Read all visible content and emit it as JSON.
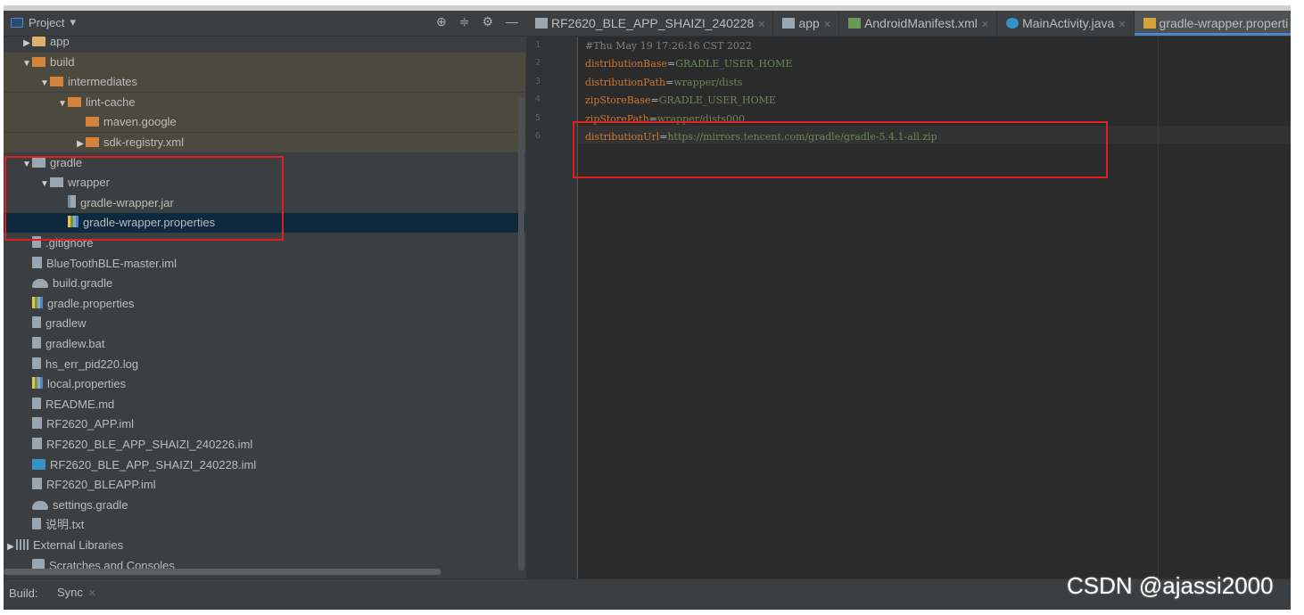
{
  "project_panel": {
    "title": "Project",
    "tools": [
      "⊕",
      "≑",
      "⚙",
      "—"
    ]
  },
  "tree": [
    {
      "depth": 1,
      "arrow": "▶",
      "icon": "folder",
      "label": "app",
      "partial": true
    },
    {
      "depth": 1,
      "arrow": "▼",
      "icon": "folder-orange",
      "label": "build"
    },
    {
      "depth": 2,
      "arrow": "▼",
      "icon": "folder-orange",
      "label": "intermediates"
    },
    {
      "depth": 3,
      "arrow": "▼",
      "icon": "folder-orange",
      "label": "lint-cache"
    },
    {
      "depth": 4,
      "arrow": "",
      "icon": "folder-orange",
      "label": "maven.google"
    },
    {
      "depth": 4,
      "arrow": "▶",
      "icon": "folder-orange",
      "label": "sdk-registry.xml"
    },
    {
      "depth": 1,
      "arrow": "▼",
      "icon": "folder-grey",
      "label": "gradle"
    },
    {
      "depth": 2,
      "arrow": "▼",
      "icon": "folder-grey",
      "label": "wrapper"
    },
    {
      "depth": 3,
      "arrow": "",
      "icon": "jar",
      "label": "gradle-wrapper.jar"
    },
    {
      "depth": 3,
      "arrow": "",
      "icon": "props",
      "label": "gradle-wrapper.properties",
      "selected": true
    },
    {
      "depth": 1,
      "arrow": "",
      "icon": "file",
      "label": ".gitignore"
    },
    {
      "depth": 1,
      "arrow": "",
      "icon": "iml",
      "label": "BlueToothBLE-master.iml"
    },
    {
      "depth": 1,
      "arrow": "",
      "icon": "gradle",
      "label": "build.gradle"
    },
    {
      "depth": 1,
      "arrow": "",
      "icon": "props",
      "label": "gradle.properties"
    },
    {
      "depth": 1,
      "arrow": "",
      "icon": "file",
      "label": "gradlew"
    },
    {
      "depth": 1,
      "arrow": "",
      "icon": "file",
      "label": "gradlew.bat"
    },
    {
      "depth": 1,
      "arrow": "",
      "icon": "file",
      "label": "hs_err_pid220.log"
    },
    {
      "depth": 1,
      "arrow": "",
      "icon": "props",
      "label": "local.properties"
    },
    {
      "depth": 1,
      "arrow": "",
      "icon": "file",
      "label": "README.md"
    },
    {
      "depth": 1,
      "arrow": "",
      "icon": "iml",
      "label": "RF2620_APP.iml"
    },
    {
      "depth": 1,
      "arrow": "",
      "icon": "iml",
      "label": "RF2620_BLE_APP_SHAIZI_240226.iml"
    },
    {
      "depth": 1,
      "arrow": "",
      "icon": "iml-blue",
      "label": "RF2620_BLE_APP_SHAIZI_240228.iml"
    },
    {
      "depth": 1,
      "arrow": "",
      "icon": "iml",
      "label": "RF2620_BLEAPP.iml"
    },
    {
      "depth": 1,
      "arrow": "",
      "icon": "gradle",
      "label": "settings.gradle"
    },
    {
      "depth": 1,
      "arrow": "",
      "icon": "file",
      "label": "说明.txt"
    },
    {
      "depth": 0,
      "arrow": "▶",
      "icon": "libs",
      "label": "External Libraries"
    },
    {
      "depth": 1,
      "arrow": "",
      "icon": "scratch",
      "label": "Scratches and Consoles"
    }
  ],
  "tabs": [
    {
      "label": "RF2620_BLE_APP_SHAIZI_240228",
      "icon": "gradle-icon"
    },
    {
      "label": "app",
      "icon": "gradle-icon"
    },
    {
      "label": "AndroidManifest.xml",
      "icon": "manifest-icon"
    },
    {
      "label": "MainActivity.java",
      "icon": "java-class-icon"
    },
    {
      "label": "gradle-wrapper.properti",
      "icon": "properties-icon",
      "active": true
    }
  ],
  "editor": {
    "lines": [
      {
        "n": "1",
        "comment": "#Thu May 19 17:26:16 CST 2022"
      },
      {
        "n": "2",
        "key": "distributionBase",
        "value": "GRADLE_USER_HOME"
      },
      {
        "n": "3",
        "key": "distributionPath",
        "value": "wrapper/dists"
      },
      {
        "n": "4",
        "key": "zipStoreBase",
        "value": "GRADLE_USER_HOME"
      },
      {
        "n": "5",
        "key": "zipStorePath",
        "value": "wrapper/dists000"
      },
      {
        "n": "6",
        "key": "distributionUrl",
        "value": "https://mirrors.tencent.com/gradle/gradle-5.4.1-all.zip"
      }
    ]
  },
  "bottom": {
    "build_label": "Build:",
    "sync_label": "Sync"
  },
  "watermark": "CSDN @ajassi2000",
  "colors": {
    "annotation_red": "#e02020",
    "selection": "#0d293e",
    "property_key": "#cc7832",
    "property_value": "#6a8759"
  }
}
